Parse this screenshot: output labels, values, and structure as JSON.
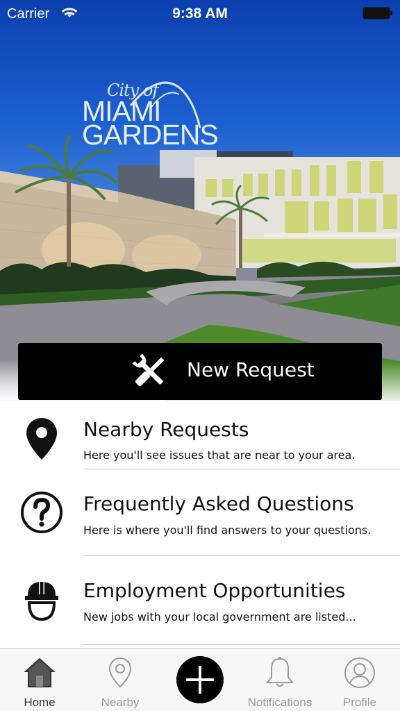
{
  "status_bar": {
    "carrier": "Carrier",
    "time": "9:38 AM"
  },
  "hero": {
    "logo_line1": "City of",
    "logo_line2": "MIAMI",
    "logo_line3": "GARDENS",
    "new_request_label": "New Request"
  },
  "menu": {
    "items": [
      {
        "title": "Nearby Requests",
        "description": "Here you'll see issues that are near to your area.",
        "icon": "map-pin-icon"
      },
      {
        "title": "Frequently Asked Questions",
        "description": "Here is where you'll find answers to your questions.",
        "icon": "question-circle-icon"
      },
      {
        "title": "Employment Opportunities",
        "description": "New jobs with your local government are listed...",
        "icon": "hard-hat-worker-icon"
      }
    ]
  },
  "tab_bar": {
    "tabs": [
      {
        "label": "Home",
        "icon": "home-icon",
        "active": true
      },
      {
        "label": "Nearby",
        "icon": "map-pin-outline-icon",
        "active": false
      },
      {
        "label": "",
        "icon": "plus-icon",
        "active": false
      },
      {
        "label": "Notifications",
        "icon": "bell-icon",
        "active": false
      },
      {
        "label": "Profile",
        "icon": "user-circle-icon",
        "active": false
      }
    ]
  },
  "colors": {
    "sky_top": "#0b3fae",
    "button_bg": "#000000",
    "tab_active_text": "#333333",
    "tab_inactive_text": "#9a9a9a"
  }
}
